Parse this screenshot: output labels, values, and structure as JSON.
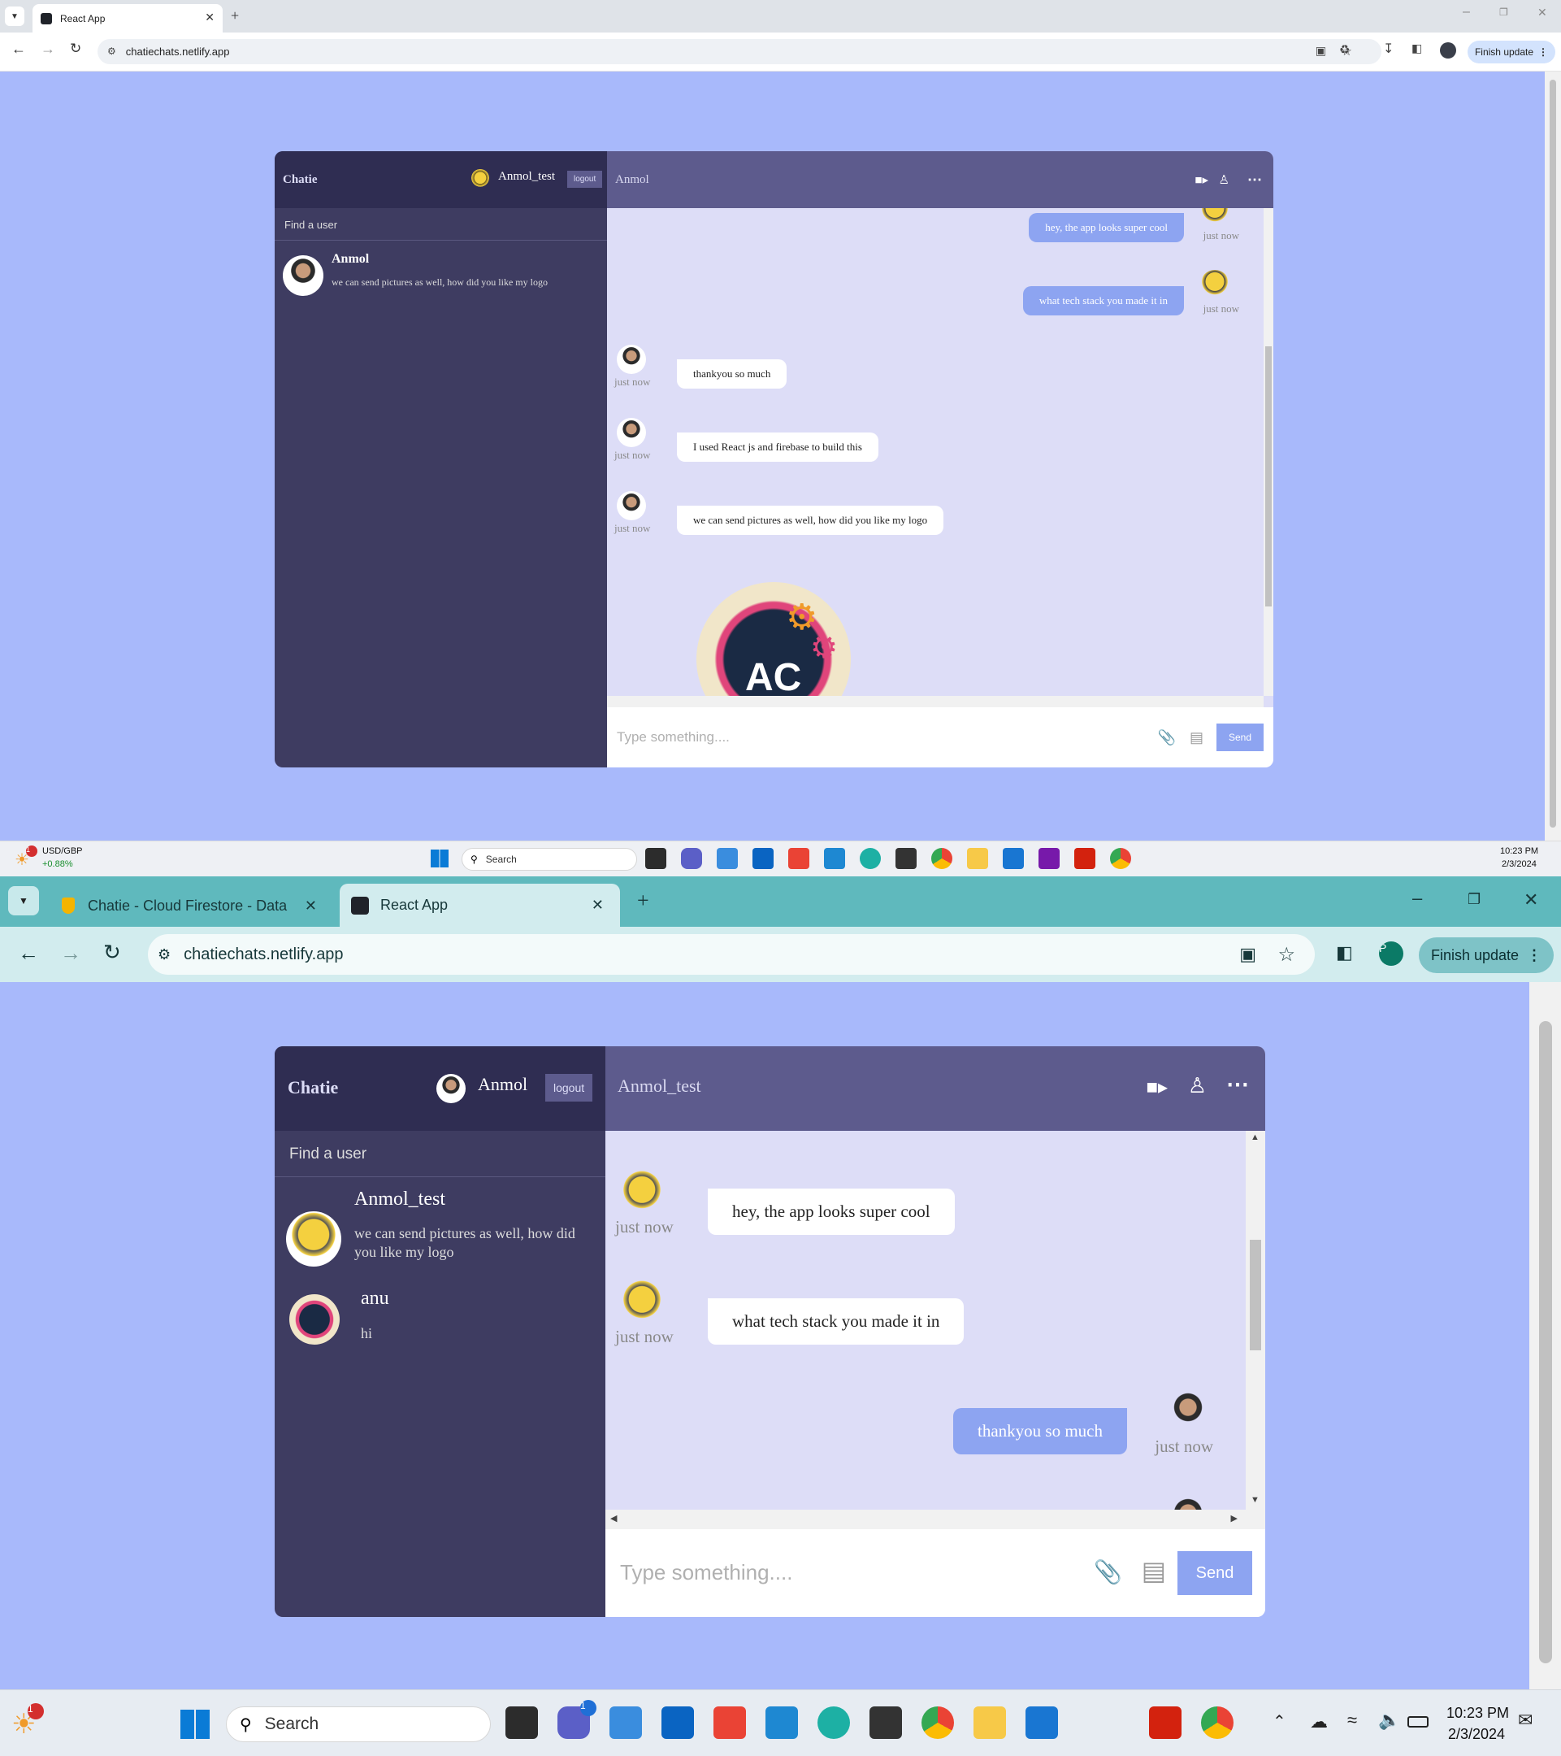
{
  "top_window": {
    "tab_title": "React App",
    "url": "chatiechats.netlify.app",
    "finish_update": "Finish update",
    "app": {
      "logo": "Chatie",
      "current_user": "Anmol_test",
      "logout": "logout",
      "search_placeholder": "Find a user",
      "chats": [
        {
          "name": "Anmol",
          "last_message": "we can send pictures as well, how did you like my logo"
        }
      ],
      "chat_title": "Anmol",
      "messages": [
        {
          "text": "hey, the app looks super cool",
          "time": "just now",
          "owner": true
        },
        {
          "text": "what tech stack you made it in",
          "time": "just now",
          "owner": true
        },
        {
          "text": "thankyou so much",
          "time": "just now",
          "owner": false
        },
        {
          "text": "I used React js and firebase to build this",
          "time": "just now",
          "owner": false
        },
        {
          "text": "we can send pictures as well, how did you like my logo",
          "time": "just now",
          "owner": false
        }
      ],
      "logo_image_text": "AC",
      "input_placeholder": "Type something....",
      "send": "Send"
    }
  },
  "taskbar_small": {
    "widget_label": "USD/GBP",
    "widget_value": "+0.88%",
    "widget_badge": "1",
    "search": "Search",
    "time": "10:23 PM",
    "date": "2/3/2024"
  },
  "bottom_window": {
    "tabs": [
      {
        "title": "Chatie - Cloud Firestore - Data"
      },
      {
        "title": "React App"
      }
    ],
    "url": "chatiechats.netlify.app",
    "profile_letter": "P",
    "finish_update": "Finish update",
    "app": {
      "logo": "Chatie",
      "current_user": "Anmol",
      "logout": "logout",
      "search_placeholder": "Find a user",
      "chats": [
        {
          "name": "Anmol_test",
          "last_message": "we can send pictures as well, how did you like my logo"
        },
        {
          "name": "anu",
          "last_message": "hi"
        }
      ],
      "chat_title": "Anmol_test",
      "messages": [
        {
          "text": "hey, the app looks super cool",
          "time": "just now",
          "owner": false
        },
        {
          "text": "what tech stack you made it in",
          "time": "just now",
          "owner": false
        },
        {
          "text": "thankyou so much",
          "time": "just now",
          "owner": true
        }
      ],
      "input_placeholder": "Type something....",
      "send": "Send"
    }
  },
  "taskbar_large": {
    "widget_badge": "1",
    "teams_badge": "1",
    "search": "Search",
    "time": "10:23 PM",
    "date": "2/3/2024"
  },
  "colors": {
    "page_bg": "#a8b9fb",
    "sidebar": "#3e3c61",
    "navbar": "#2f2d52",
    "chat_header": "#5d5b8d",
    "messages_bg": "#ddddf7",
    "owner_bubble": "#8da4f1"
  }
}
